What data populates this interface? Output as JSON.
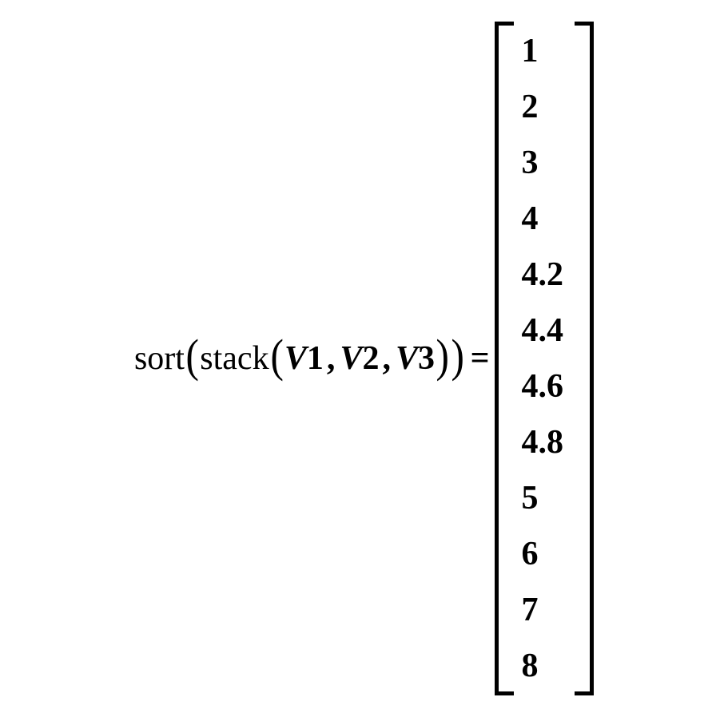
{
  "expression": {
    "outer_func": "sort",
    "inner_func": "stack",
    "args": [
      {
        "var": "V",
        "sub": "1"
      },
      {
        "var": "V",
        "sub": "2"
      },
      {
        "var": "V",
        "sub": "3"
      }
    ],
    "equals": "="
  },
  "result_vector": [
    "1",
    "2",
    "3",
    "4",
    "4.2",
    "4.4",
    "4.6",
    "4.8",
    "5",
    "6",
    "7",
    "8"
  ]
}
